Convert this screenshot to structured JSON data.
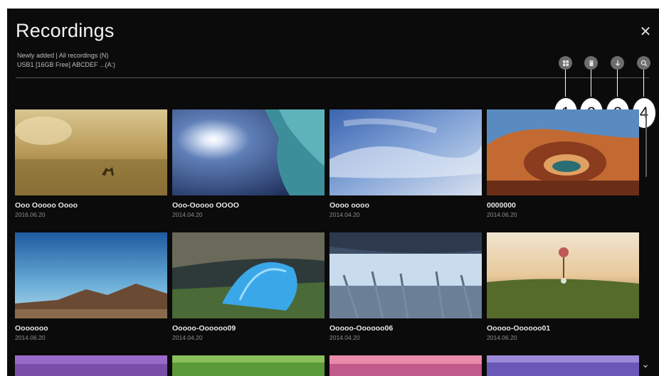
{
  "header": {
    "title": "Recordings",
    "filter_text": "Newly added | All recordings (N)",
    "storage_text": "USB1 [16GB Free] ABCDEF ...(A:)"
  },
  "toolbar": {
    "buttons": [
      {
        "icon": "select-icon",
        "callout": "1"
      },
      {
        "icon": "delete-icon",
        "callout": "2"
      },
      {
        "icon": "sort-icon",
        "callout": "3"
      },
      {
        "icon": "search-icon",
        "callout": "4"
      }
    ]
  },
  "close_icon": "close-icon",
  "recordings": [
    {
      "title": "Ooo Ooooo Oooo",
      "date": "2016.06.20"
    },
    {
      "title": "Ooo-Ooooo OOOO",
      "date": "2014.04.20"
    },
    {
      "title": "Oooo oooo",
      "date": "2014.04.20"
    },
    {
      "title": "0000000",
      "date": "2014.06.20"
    },
    {
      "title": "Ooooooo",
      "date": "2014.06.20"
    },
    {
      "title": "Ooooo-Oooooo09",
      "date": "2014.04.20"
    },
    {
      "title": "Ooooo-Oooooo06",
      "date": "2014.04.20"
    },
    {
      "title": "Ooooo-Oooooo01",
      "date": "2014.06.20"
    }
  ],
  "colors": {
    "background": "#0b0b0b",
    "toolbar_button": "#6d6d6d",
    "text": "#e6e6e6"
  }
}
